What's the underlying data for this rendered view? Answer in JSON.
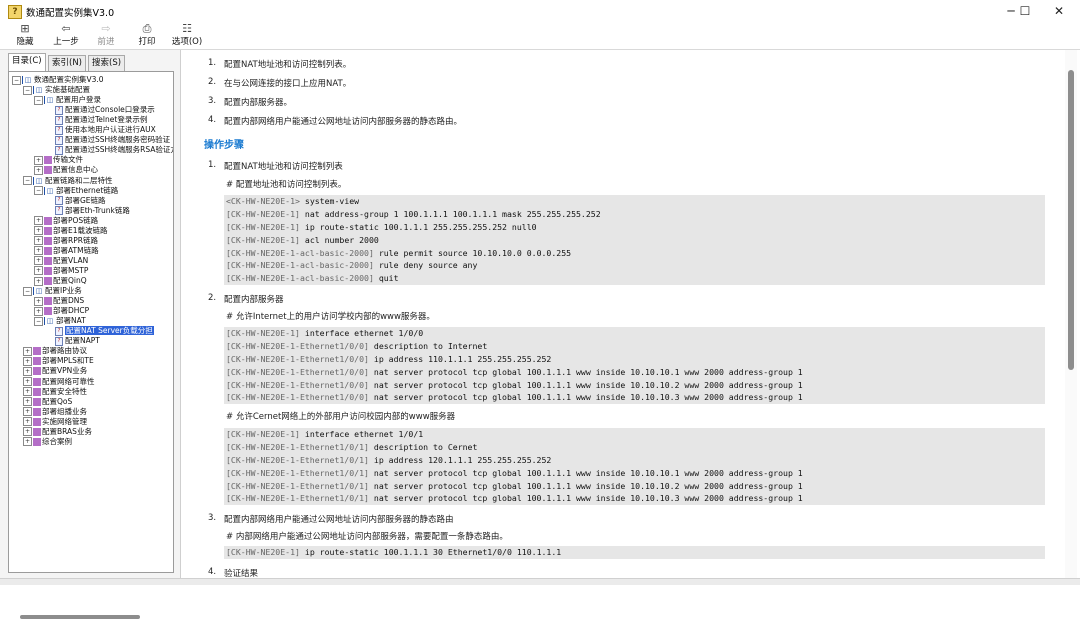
{
  "window": {
    "title": "数通配置实例集V3.0",
    "minimize": "─",
    "maximize": "☐",
    "close": "✕"
  },
  "toolbar": {
    "hide": {
      "label": "隐藏",
      "icon": "⊞"
    },
    "back": {
      "label": "上一步",
      "icon": "⇦"
    },
    "forward": {
      "label": "前进",
      "icon": "⇨"
    },
    "print": {
      "label": "打印",
      "icon": "⎙"
    },
    "options": {
      "label": "选项(O)",
      "icon": "☷"
    }
  },
  "sidebar": {
    "tabs": [
      {
        "label": "目录(C)"
      },
      {
        "label": "索引(N)"
      },
      {
        "label": "搜索(S)"
      }
    ],
    "tree": [
      {
        "label": "数通配置实例集V3.0",
        "depth": 0,
        "expander": "−",
        "icon": "book-open"
      },
      {
        "label": "实施基础配置",
        "depth": 1,
        "expander": "−",
        "icon": "book-open"
      },
      {
        "label": "配置用户登录",
        "depth": 2,
        "expander": "−",
        "icon": "book-open"
      },
      {
        "label": "配置通过Console口登录示",
        "depth": 3,
        "expander": "",
        "icon": "page"
      },
      {
        "label": "配置通过Telnet登录示例",
        "depth": 3,
        "expander": "",
        "icon": "page"
      },
      {
        "label": "使用本地用户认证进行AUX",
        "depth": 3,
        "expander": "",
        "icon": "page"
      },
      {
        "label": "配置通过SSH终端服务密码验证",
        "depth": 3,
        "expander": "",
        "icon": "page"
      },
      {
        "label": "配置通过SSH终端服务RSA验证方",
        "depth": 3,
        "expander": "",
        "icon": "page"
      },
      {
        "label": "传输文件",
        "depth": 2,
        "expander": "+",
        "icon": "book-closed"
      },
      {
        "label": "配置信息中心",
        "depth": 2,
        "expander": "+",
        "icon": "book-closed"
      },
      {
        "label": "配置链路和二层特性",
        "depth": 1,
        "expander": "−",
        "icon": "book-open"
      },
      {
        "label": "部署Ethernet链路",
        "depth": 2,
        "expander": "−",
        "icon": "book-open"
      },
      {
        "label": "部署GE链路",
        "depth": 3,
        "expander": "",
        "icon": "page"
      },
      {
        "label": "部署Eth-Trunk链路",
        "depth": 3,
        "expander": "",
        "icon": "page"
      },
      {
        "label": "部署POS链路",
        "depth": 2,
        "expander": "+",
        "icon": "book-closed"
      },
      {
        "label": "部署E1载波链路",
        "depth": 2,
        "expander": "+",
        "icon": "book-closed"
      },
      {
        "label": "部署RPR链路",
        "depth": 2,
        "expander": "+",
        "icon": "book-closed"
      },
      {
        "label": "部署ATM链路",
        "depth": 2,
        "expander": "+",
        "icon": "book-closed"
      },
      {
        "label": "配置VLAN",
        "depth": 2,
        "expander": "+",
        "icon": "book-closed"
      },
      {
        "label": "部署MSTP",
        "depth": 2,
        "expander": "+",
        "icon": "book-closed"
      },
      {
        "label": "配置QinQ",
        "depth": 2,
        "expander": "+",
        "icon": "book-closed"
      },
      {
        "label": "配置IP业务",
        "depth": 1,
        "expander": "−",
        "icon": "book-open"
      },
      {
        "label": "配置DNS",
        "depth": 2,
        "expander": "+",
        "icon": "book-closed"
      },
      {
        "label": "部署DHCP",
        "depth": 2,
        "expander": "+",
        "icon": "book-closed"
      },
      {
        "label": "部署NAT",
        "depth": 2,
        "expander": "−",
        "icon": "book-open"
      },
      {
        "label": "配置NAT Server负载分担",
        "depth": 3,
        "expander": "",
        "icon": "page",
        "selected": true
      },
      {
        "label": "配置NAPT",
        "depth": 3,
        "expander": "",
        "icon": "page"
      },
      {
        "label": "部署路由协议",
        "depth": 1,
        "expander": "+",
        "icon": "book-closed"
      },
      {
        "label": "部署MPLS和TE",
        "depth": 1,
        "expander": "+",
        "icon": "book-closed"
      },
      {
        "label": "配置VPN业务",
        "depth": 1,
        "expander": "+",
        "icon": "book-closed"
      },
      {
        "label": "配置网络可靠性",
        "depth": 1,
        "expander": "+",
        "icon": "book-closed"
      },
      {
        "label": "配置安全特性",
        "depth": 1,
        "expander": "+",
        "icon": "book-closed"
      },
      {
        "label": "配置QoS",
        "depth": 1,
        "expander": "+",
        "icon": "book-closed"
      },
      {
        "label": "部署组播业务",
        "depth": 1,
        "expander": "+",
        "icon": "book-closed"
      },
      {
        "label": "实施网络管理",
        "depth": 1,
        "expander": "+",
        "icon": "book-closed"
      },
      {
        "label": "配置BRAS业务",
        "depth": 1,
        "expander": "+",
        "icon": "book-closed"
      },
      {
        "label": "综合案例",
        "depth": 1,
        "expander": "+",
        "icon": "book-closed"
      }
    ]
  },
  "content": {
    "overview": [
      {
        "num": "1.",
        "text": "配置NAT地址池和访问控制列表。"
      },
      {
        "num": "2.",
        "text": "在与公网连接的接口上应用NAT。"
      },
      {
        "num": "3.",
        "text": "配置内部服务器。"
      },
      {
        "num": "4.",
        "text": "配置内部网络用户能通过公网地址访问内部服务器的静态路由。"
      }
    ],
    "steps_heading": "操作步骤",
    "step1": {
      "num": "1.",
      "title": "配置NAT地址池和访问控制列表",
      "comment": "# 配置地址池和访问控制列表。",
      "code": [
        {
          "prompt": "<CK-HW-NE20E-1>",
          "cmd": "system-view"
        },
        {
          "prompt": "[CK-HW-NE20E-1]",
          "cmd": "nat address-group 1 100.1.1.1 100.1.1.1 mask 255.255.255.252"
        },
        {
          "prompt": "[CK-HW-NE20E-1]",
          "cmd": "ip route-static 100.1.1.1 255.255.255.252 null0"
        },
        {
          "prompt": "[CK-HW-NE20E-1]",
          "cmd": "acl number 2000"
        },
        {
          "prompt": "[CK-HW-NE20E-1-acl-basic-2000]",
          "cmd": "rule permit source 10.10.10.0 0.0.0.255"
        },
        {
          "prompt": "[CK-HW-NE20E-1-acl-basic-2000]",
          "cmd": "rule deny source any"
        },
        {
          "prompt": "[CK-HW-NE20E-1-acl-basic-2000]",
          "cmd": "quit"
        }
      ]
    },
    "step2": {
      "num": "2.",
      "title": "配置内部服务器",
      "comment1": "# 允许Internet上的用户访问学校内部的www服务器。",
      "code1": [
        {
          "prompt": "[CK-HW-NE20E-1]",
          "cmd": "interface ethernet 1/0/0"
        },
        {
          "prompt": "[CK-HW-NE20E-1-Ethernet1/0/0]",
          "cmd": "description to Internet"
        },
        {
          "prompt": "[CK-HW-NE20E-1-Ethernet1/0/0]",
          "cmd": "ip address 110.1.1.1 255.255.255.252"
        },
        {
          "prompt": "[CK-HW-NE20E-1-Ethernet1/0/0]",
          "cmd": "nat server protocol tcp global 100.1.1.1 www inside 10.10.10.1 www 2000 address-group 1"
        },
        {
          "prompt": "[CK-HW-NE20E-1-Ethernet1/0/0]",
          "cmd": "nat server protocol tcp global 100.1.1.1 www inside 10.10.10.2 www 2000 address-group 1"
        },
        {
          "prompt": "[CK-HW-NE20E-1-Ethernet1/0/0]",
          "cmd": "nat server protocol tcp global 100.1.1.1 www inside 10.10.10.3 www 2000 address-group 1"
        }
      ],
      "comment2": "# 允许Cernet网络上的外部用户访问校园内部的www服务器",
      "code2": [
        {
          "prompt": "[CK-HW-NE20E-1]",
          "cmd": "interface ethernet 1/0/1"
        },
        {
          "prompt": "[CK-HW-NE20E-1-Ethernet1/0/1]",
          "cmd": "description to Cernet"
        },
        {
          "prompt": "[CK-HW-NE20E-1-Ethernet1/0/1]",
          "cmd": "ip address 120.1.1.1 255.255.255.252"
        },
        {
          "prompt": "[CK-HW-NE20E-1-Ethernet1/0/1]",
          "cmd": "nat server protocol tcp global 100.1.1.1 www inside 10.10.10.1 www 2000 address-group 1"
        },
        {
          "prompt": "[CK-HW-NE20E-1-Ethernet1/0/1]",
          "cmd": "nat server protocol tcp global 100.1.1.1 www inside 10.10.10.2 www 2000 address-group 1"
        },
        {
          "prompt": "[CK-HW-NE20E-1-Ethernet1/0/1]",
          "cmd": "nat server protocol tcp global 100.1.1.1 www inside 10.10.10.3 www 2000 address-group 1"
        }
      ]
    },
    "step3": {
      "num": "3.",
      "title": "配置内部网络用户能通过公网地址访问内部服务器的静态路由",
      "comment": "# 内部网络用户能通过公网地址访问内部服务器，需要配置一条静态路由。",
      "code": [
        {
          "prompt": "[CK-HW-NE20E-1]",
          "cmd": "ip route-static 100.1.1.1 30 Ethernet1/0/0 110.1.1.1"
        }
      ]
    },
    "step4": {
      "num": "4.",
      "title": "验证结果"
    }
  }
}
